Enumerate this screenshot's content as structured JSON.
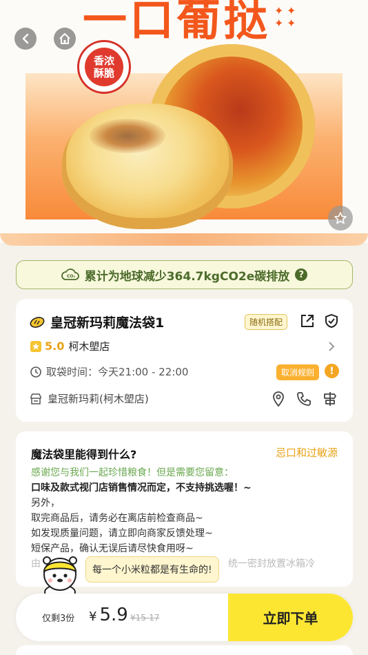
{
  "hero": {
    "title": "一口葡挞",
    "stamp": "香浓酥脆"
  },
  "carbon": {
    "text": "累计为地球减少364.7kgCO2e碳排放",
    "help": "?"
  },
  "shop": {
    "title": "皇冠新玛莉魔法袋1",
    "random_tag": "随机搭配",
    "rating": "5.0",
    "area": "柯木塱店",
    "pickup_time": "取袋时间：今天21:00 - 22:00",
    "cancel_tag": "取消规则",
    "alert": "!",
    "store": "皇冠新玛莉(柯木塱店)"
  },
  "bag": {
    "title": "魔法袋里能得到什么?",
    "link": "忌口和过敏源",
    "line1": "感谢您与我们一起珍惜粮食！但是需要您留意：",
    "line2": "口味及款式视门店销售情况而定，不支持挑选喔！~",
    "line3": "另外，",
    "line4": "取完商品后，请务必在离店前检查商品~",
    "line5": "如发现质量问题，请立即向商家反馈处理~",
    "line6": "短保产品，确认无误后请尽快食用呀~",
    "line7a": "由",
    "line7b": "统一密封放置冰箱冷"
  },
  "mascot": {
    "speech": "每一个小米粒都是有生命的!"
  },
  "bottom": {
    "stock": "仅剩3份",
    "currency": "¥",
    "price": "5.9",
    "original": "¥15-17",
    "order": "立即下单"
  }
}
